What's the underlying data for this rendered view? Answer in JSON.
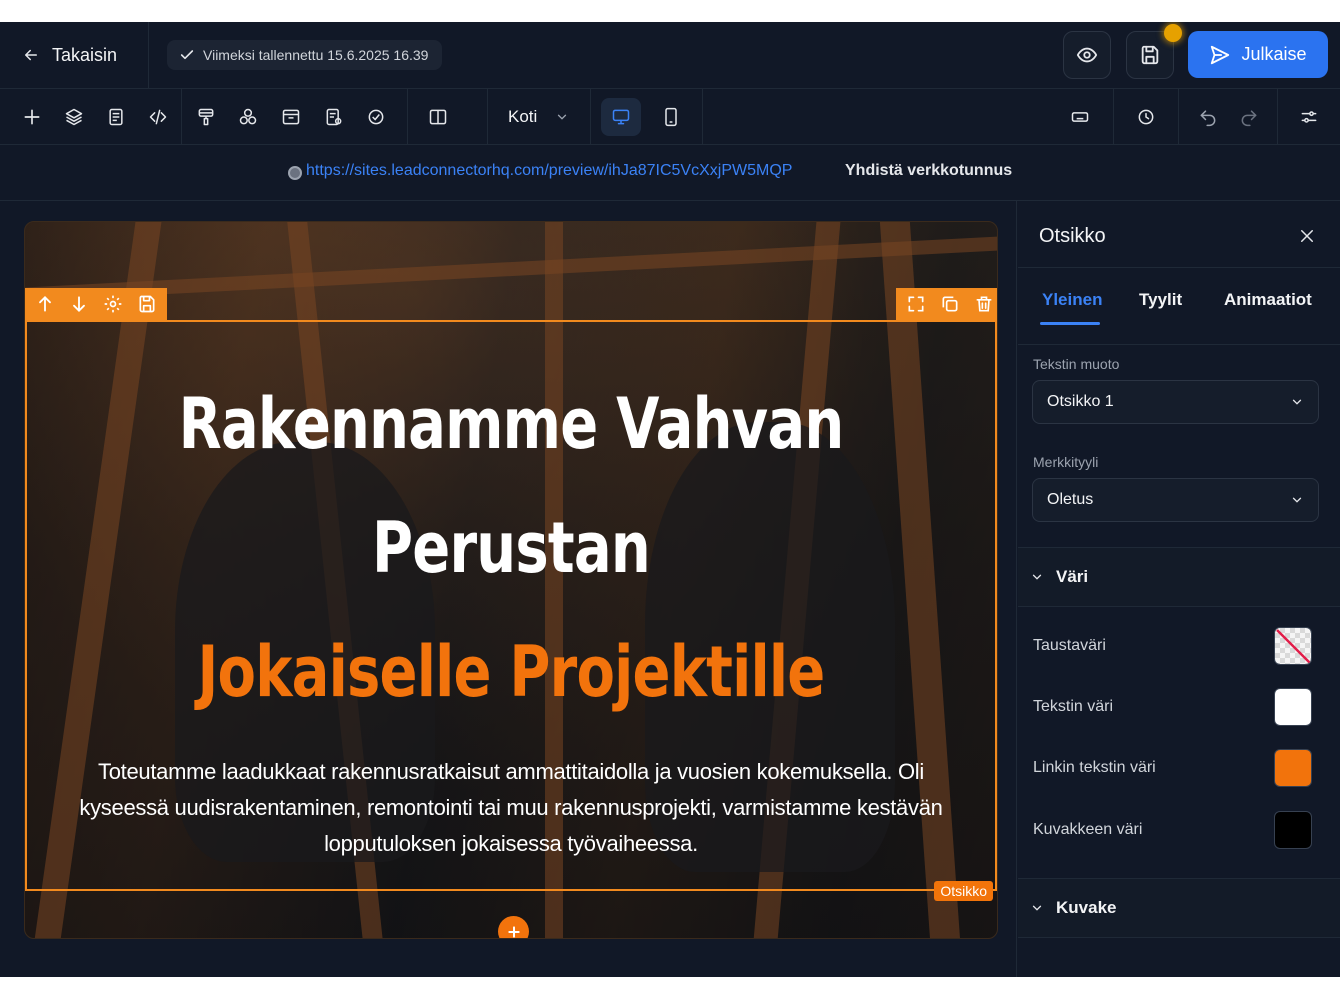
{
  "header": {
    "back_label": "Takaisin",
    "saved_status": "Viimeksi tallennettu 15.6.2025 16.39",
    "publish_label": "Julkaise"
  },
  "toolbar": {
    "page_select": "Koti",
    "left_tools": [
      "add-icon",
      "layers-icon",
      "pages-icon",
      "code-icon",
      "paint-icon",
      "apps-icon",
      "popup-icon",
      "forms-icon",
      "integrations-icon",
      "columns-icon"
    ],
    "devices": [
      "desktop-icon",
      "mobile-icon"
    ],
    "active_device": "desktop",
    "right_tools": [
      "keyboard-icon",
      "history-icon",
      "undo-icon",
      "redo-icon",
      "settings-sliders-icon"
    ]
  },
  "urlbar": {
    "url": "https://sites.leadconnectorhq.com/preview/ihJa87IC5VcXxjPW5MQP",
    "connect_domain": "Yhdistä verkkotunnus"
  },
  "canvas": {
    "heading_line1": "Rakennamme Vahvan",
    "heading_line2": "Perustan",
    "heading_line3": "Jokaiselle Projektille",
    "body": "Toteutamme laadukkaat rakennusratkaisut ammattitaidolla ja vuosien kokemuksella. Oli kyseessä uudisrakentaminen, remontointi tai muu rakennusprojekti, varmistamme kestävän lopputuloksen jokaisessa työvaiheessa.",
    "selection_tag": "Otsikko",
    "accent_color": "#f2730c"
  },
  "panel": {
    "title": "Otsikko",
    "tabs": [
      "Yleinen",
      "Tyylit",
      "Animaatiot"
    ],
    "active_tab": "Yleinen",
    "text_format_label": "Tekstin muoto",
    "text_format_value": "Otsikko 1",
    "char_style_label": "Merkkityyli",
    "char_style_value": "Oletus",
    "color_section": "Väri",
    "colors": [
      {
        "label": "Taustaväri",
        "value": "transparent"
      },
      {
        "label": "Tekstin väri",
        "value": "#ffffff"
      },
      {
        "label": "Linkin tekstin väri",
        "value": "#f2730c"
      },
      {
        "label": "Kuvakkeen väri",
        "value": "#000000"
      }
    ],
    "icon_section": "Kuvake"
  }
}
